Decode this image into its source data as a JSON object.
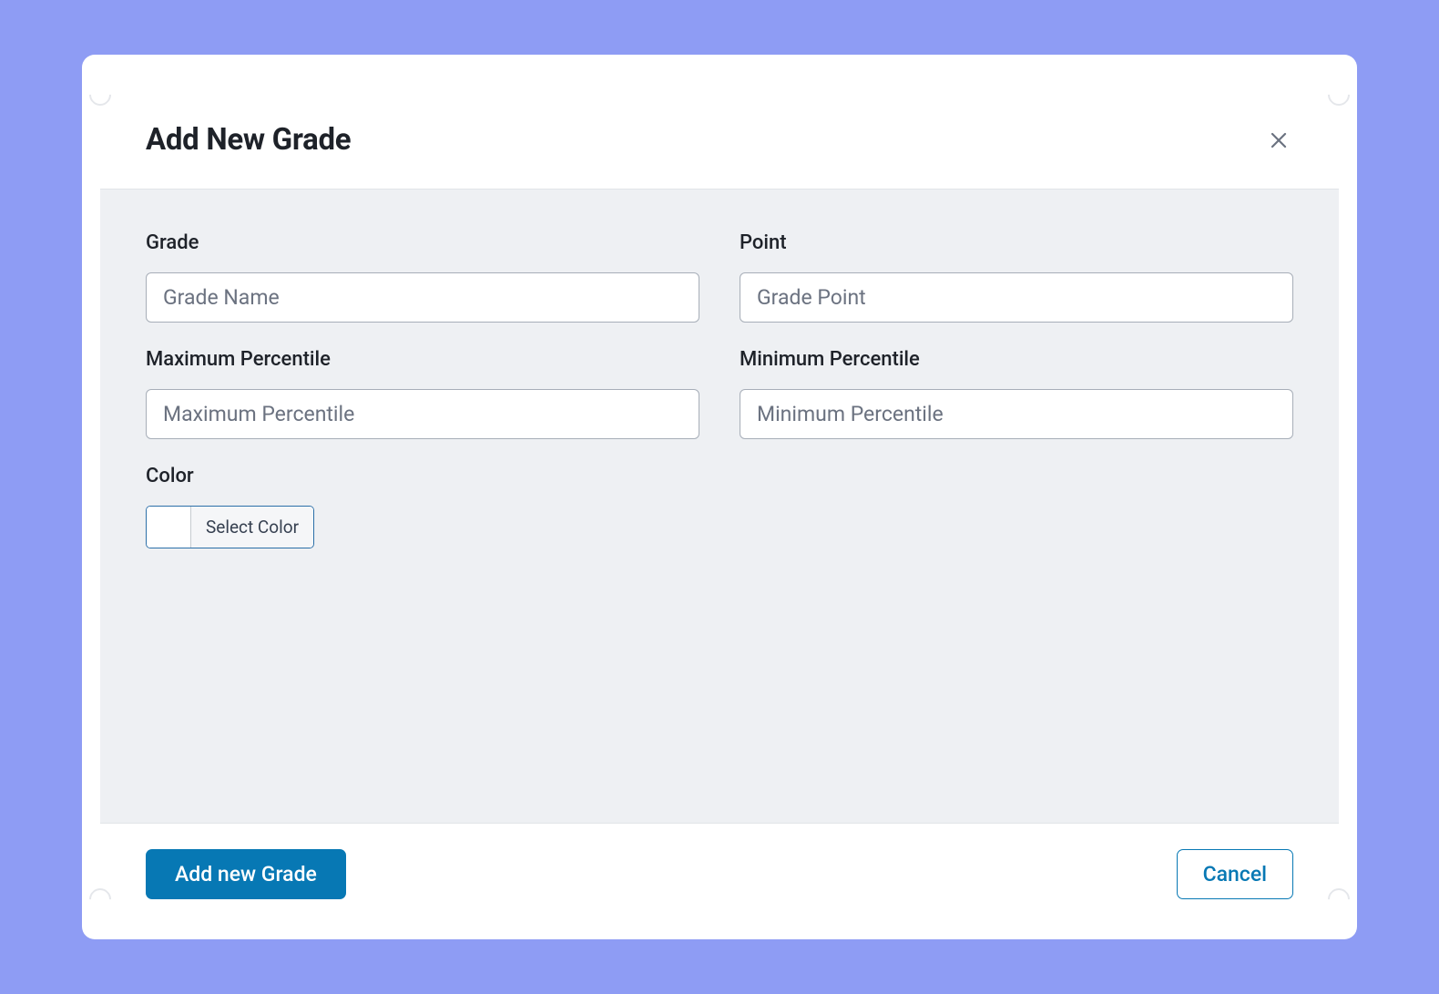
{
  "modal": {
    "title": "Add New Grade",
    "fields": {
      "grade": {
        "label": "Grade",
        "placeholder": "Grade Name"
      },
      "point": {
        "label": "Point",
        "placeholder": "Grade Point"
      },
      "maxPercentile": {
        "label": "Maximum Percentile",
        "placeholder": "Maximum Percentile"
      },
      "minPercentile": {
        "label": "Minimum Percentile",
        "placeholder": "Minimum Percentile"
      },
      "color": {
        "label": "Color",
        "buttonText": "Select Color"
      }
    },
    "actions": {
      "submit": "Add new Grade",
      "cancel": "Cancel"
    }
  }
}
